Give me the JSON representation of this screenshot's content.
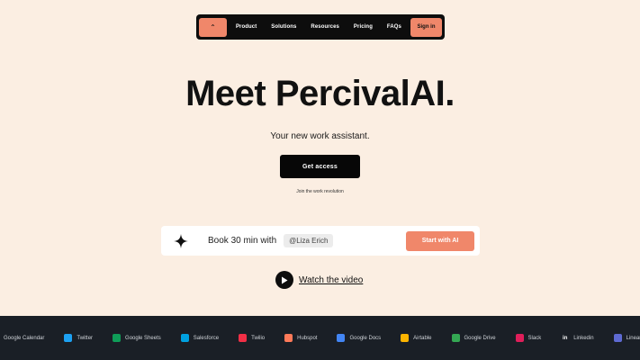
{
  "nav": {
    "logo_glyph": "⌃",
    "links": [
      "Product",
      "Solutions",
      "Resources",
      "Pricing",
      "FAQs"
    ],
    "signin_label": "Sign in"
  },
  "hero": {
    "title": "Meet PercivalAI.",
    "subtitle": "Your new work assistant.",
    "cta_label": "Get access",
    "cta_note": "Join the work revolution"
  },
  "booker": {
    "text": "Book 30 min with",
    "tag": "@Liza Erich",
    "button_label": "Start with AI"
  },
  "watch": {
    "label": "Watch the video"
  },
  "integrations": [
    {
      "label": "Google Calendar",
      "icon": "google-calendar-icon",
      "color": "#4285f4",
      "glyph": ""
    },
    {
      "label": "Twitter",
      "icon": "twitter-icon",
      "color": "#1da1f2",
      "glyph": ""
    },
    {
      "label": "Google Sheets",
      "icon": "google-sheets-icon",
      "color": "#0f9d58",
      "glyph": ""
    },
    {
      "label": "Salesforce",
      "icon": "salesforce-icon",
      "color": "#00a1e0",
      "glyph": ""
    },
    {
      "label": "Twilio",
      "icon": "twilio-icon",
      "color": "#f22f46",
      "glyph": ""
    },
    {
      "label": "Hubspot",
      "icon": "hubspot-icon",
      "color": "#ff7a59",
      "glyph": ""
    },
    {
      "label": "Google Docs",
      "icon": "google-docs-icon",
      "color": "#4285f4",
      "glyph": ""
    },
    {
      "label": "Airtable",
      "icon": "airtable-icon",
      "color": "#fcb400",
      "glyph": ""
    },
    {
      "label": "Google Drive",
      "icon": "google-drive-icon",
      "color": "#34a853",
      "glyph": ""
    },
    {
      "label": "Slack",
      "icon": "slack-icon",
      "color": "#e01e5a",
      "glyph": ""
    },
    {
      "label": "Linkedin",
      "icon": "linkedin-icon",
      "color": "#1a1f26",
      "glyph": "in"
    },
    {
      "label": "Linear",
      "icon": "linear-icon",
      "color": "#5e6ad2",
      "glyph": ""
    }
  ]
}
